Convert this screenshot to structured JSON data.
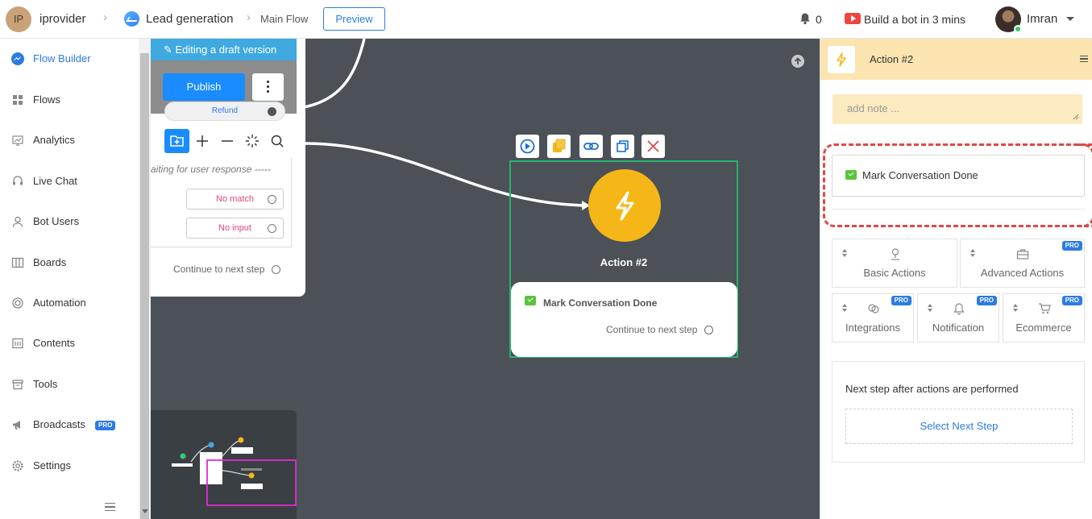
{
  "header": {
    "workspace_initials": "IP",
    "workspace_name": "iprovider",
    "flow_name": "Lead generation",
    "subflow_name": "Main Flow",
    "preview_label": "Preview",
    "notification_count": "0",
    "build_bot_label": "Build a bot in 3 mins",
    "user_name": "Imran"
  },
  "sidebar": {
    "items": [
      {
        "label": "Flow Builder",
        "icon": "messenger-icon",
        "active": true
      },
      {
        "label": "Flows",
        "icon": "grid-icon"
      },
      {
        "label": "Analytics",
        "icon": "chart-icon"
      },
      {
        "label": "Live Chat",
        "icon": "headset-icon"
      },
      {
        "label": "Bot Users",
        "icon": "user-icon"
      },
      {
        "label": "Boards",
        "icon": "board-icon"
      },
      {
        "label": "Automation",
        "icon": "automation-icon"
      },
      {
        "label": "Contents",
        "icon": "contents-icon"
      },
      {
        "label": "Tools",
        "icon": "tools-icon"
      },
      {
        "label": "Broadcasts",
        "icon": "megaphone-icon",
        "badge": "PRO"
      },
      {
        "label": "Settings",
        "icon": "gear-icon"
      }
    ]
  },
  "canvas": {
    "draft_banner": "Editing a draft version",
    "publish_label": "Publish",
    "refund_label": "Refund",
    "waiting_text": "aiting for user response -----",
    "no_match_label": "No match",
    "no_input_label": "No input",
    "continue_left": "Continue to next step",
    "node": {
      "title": "Action #2",
      "action_label": "Mark Conversation Done",
      "continue_label": "Continue to next step",
      "accent": "#f5b617",
      "selected_border": "#24b36b"
    }
  },
  "panel": {
    "title": "Action #2",
    "note_placeholder": "add note ...",
    "action_item": "Mark Conversation Done",
    "tiles": [
      {
        "label": "Basic Actions",
        "icon": "user-pin-icon",
        "pro": false
      },
      {
        "label": "Advanced Actions",
        "icon": "briefcase-icon",
        "pro": true
      },
      {
        "label": "Integrations",
        "icon": "link-icon",
        "pro": true
      },
      {
        "label": "Notification",
        "icon": "bell-icon",
        "pro": true
      },
      {
        "label": "Ecommerce",
        "icon": "cart-icon",
        "pro": true
      }
    ],
    "pro_badge": "PRO",
    "next_step_title": "Next step after actions are performed",
    "select_next_label": "Select Next Step"
  }
}
